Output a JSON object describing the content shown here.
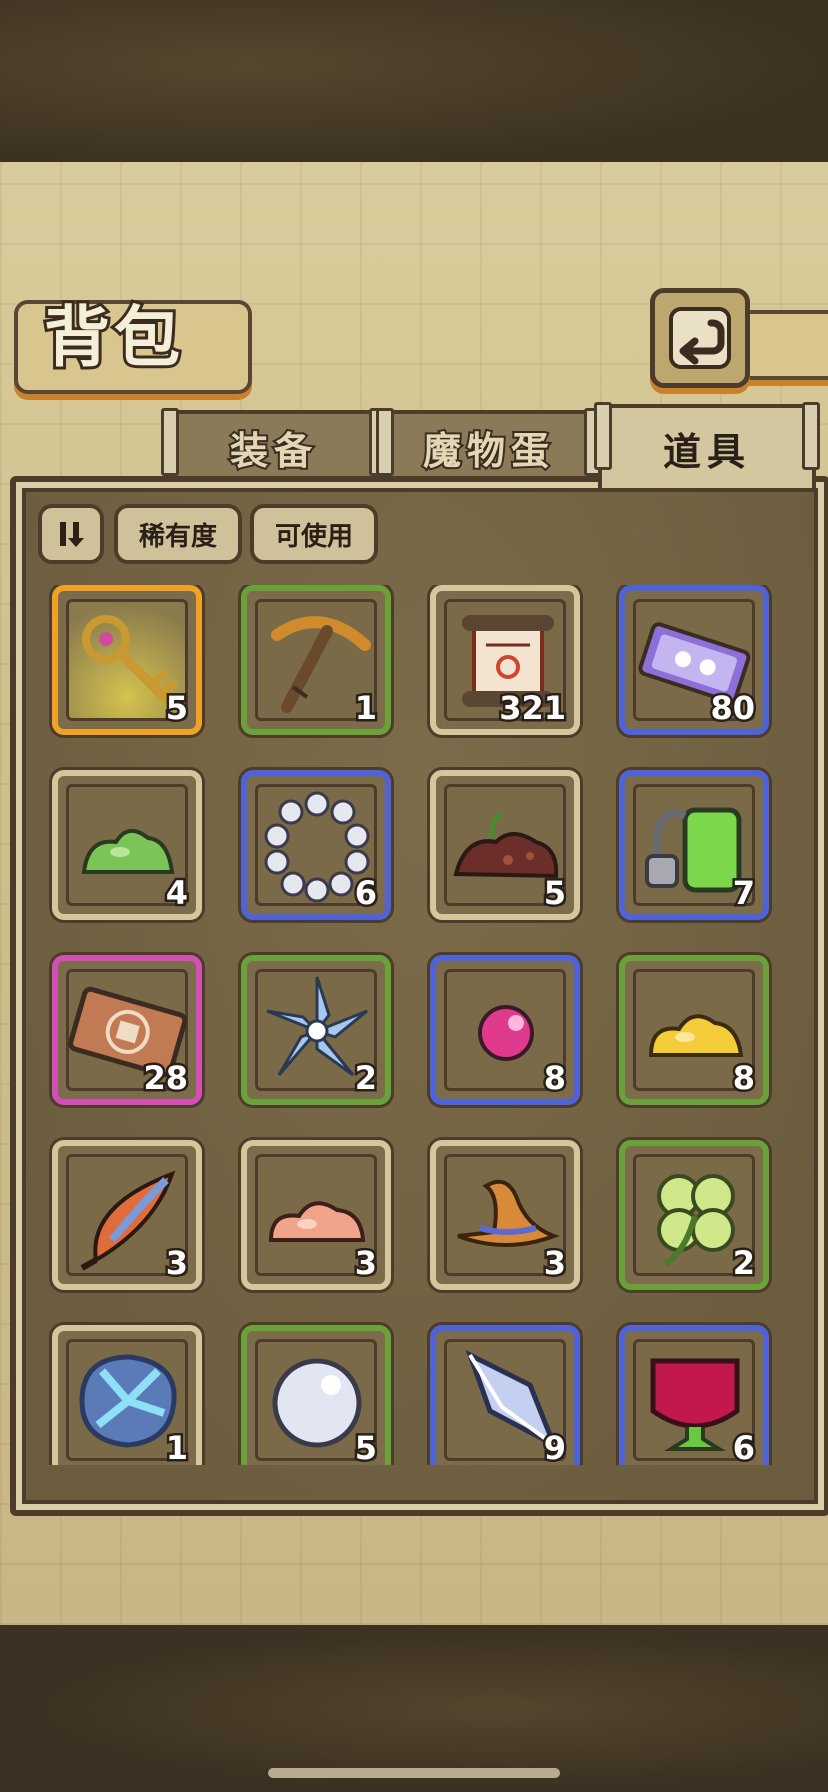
{
  "title": "背包",
  "tabs": [
    {
      "label": "装备",
      "active": false
    },
    {
      "label": "魔物蛋",
      "active": false
    },
    {
      "label": "道具",
      "active": true
    }
  ],
  "filters": {
    "sort_icon": "sort-toggle-icon",
    "rarity_label": "稀有度",
    "usable_label": "可使用"
  },
  "items": [
    {
      "icon": "golden-key-icon",
      "count": "5",
      "rarity": "gold"
    },
    {
      "icon": "pickaxe-icon",
      "count": "1",
      "rarity": "green"
    },
    {
      "icon": "scroll-icon",
      "count": "321",
      "rarity": "common"
    },
    {
      "icon": "ticket-icon",
      "count": "80",
      "rarity": "blue"
    },
    {
      "icon": "green-slime-icon",
      "count": "4",
      "rarity": "common"
    },
    {
      "icon": "pearl-ring-icon",
      "count": "6",
      "rarity": "blue"
    },
    {
      "icon": "soil-pile-icon",
      "count": "5",
      "rarity": "common"
    },
    {
      "icon": "potion-tank-icon",
      "count": "7",
      "rarity": "blue"
    },
    {
      "icon": "card-icon",
      "count": "28",
      "rarity": "purple"
    },
    {
      "icon": "blue-flower-icon",
      "count": "2",
      "rarity": "green"
    },
    {
      "icon": "pink-orb-icon",
      "count": "8",
      "rarity": "blue"
    },
    {
      "icon": "yellow-slime-icon",
      "count": "8",
      "rarity": "green"
    },
    {
      "icon": "feather-icon",
      "count": "3",
      "rarity": "common"
    },
    {
      "icon": "pink-slime-icon",
      "count": "3",
      "rarity": "common"
    },
    {
      "icon": "witch-hat-icon",
      "count": "3",
      "rarity": "common"
    },
    {
      "icon": "clover-icon",
      "count": "2",
      "rarity": "green"
    },
    {
      "icon": "shell-icon",
      "count": "1",
      "rarity": "common"
    },
    {
      "icon": "white-pearl-icon",
      "count": "5",
      "rarity": "green"
    },
    {
      "icon": "crystal-icon",
      "count": "9",
      "rarity": "blue"
    },
    {
      "icon": "red-goblet-icon",
      "count": "6",
      "rarity": "blue"
    }
  ],
  "colors": {
    "common": "#d6c69c",
    "green": "#6aa23a",
    "blue": "#4f63d8",
    "gold": "#f0a226",
    "purple": "#d24fb6"
  }
}
